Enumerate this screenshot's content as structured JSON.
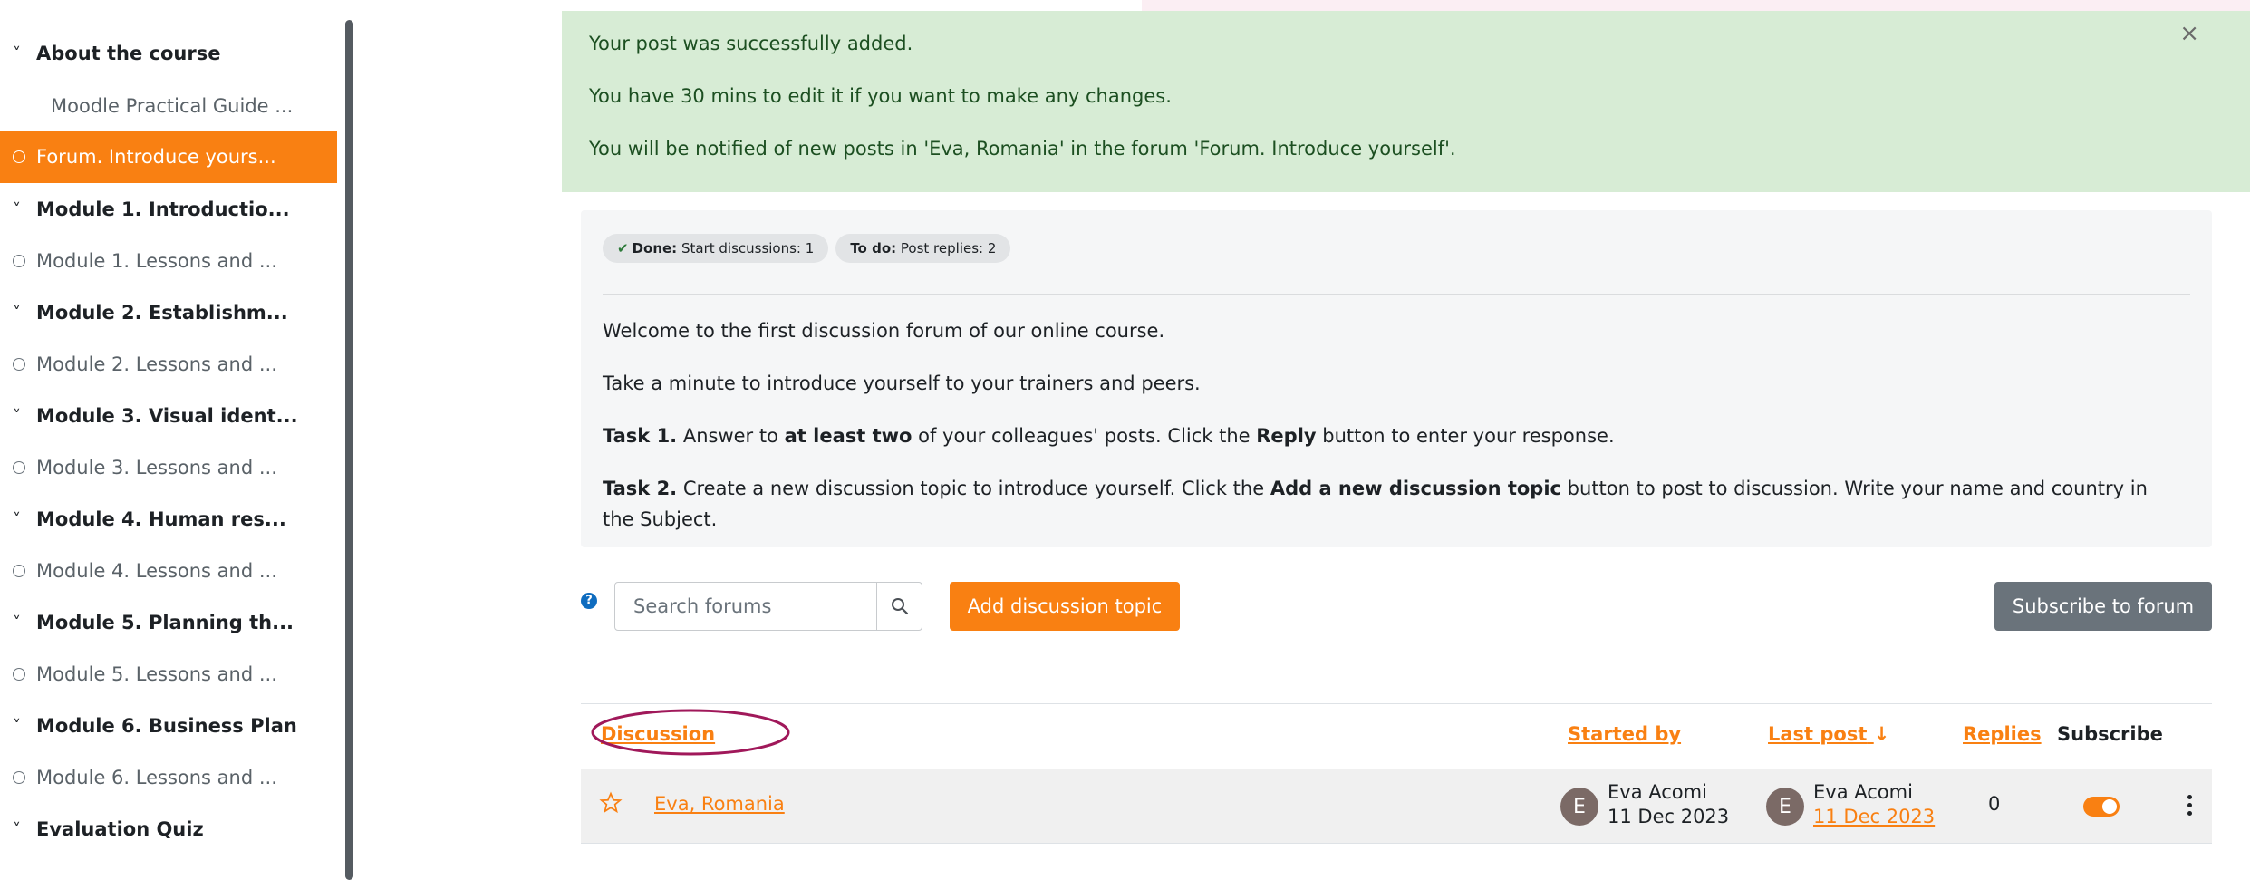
{
  "sidebar": {
    "items": [
      {
        "label": "About the course",
        "kind": "section"
      },
      {
        "label": "Moodle Practical Guide ...",
        "kind": "indent"
      },
      {
        "label": "Forum. Introduce yours...",
        "kind": "activity",
        "active": true
      },
      {
        "label": "Module 1. Introductio...",
        "kind": "section"
      },
      {
        "label": "Module 1. Lessons and ...",
        "kind": "activity"
      },
      {
        "label": "Module 2. Establishm...",
        "kind": "section"
      },
      {
        "label": "Module 2. Lessons and ...",
        "kind": "activity"
      },
      {
        "label": "Module 3. Visual ident...",
        "kind": "section"
      },
      {
        "label": "Module 3. Lessons and ...",
        "kind": "activity"
      },
      {
        "label": "Module 4. Human res...",
        "kind": "section"
      },
      {
        "label": "Module 4. Lessons and ...",
        "kind": "activity"
      },
      {
        "label": "Module 5. Planning th...",
        "kind": "section"
      },
      {
        "label": "Module 5. Lessons and ...",
        "kind": "activity"
      },
      {
        "label": "Module 6. Business Plan",
        "kind": "section"
      },
      {
        "label": "Module 6. Lessons and ...",
        "kind": "activity"
      },
      {
        "label": "Evaluation Quiz",
        "kind": "section"
      }
    ]
  },
  "alert": {
    "line1": "Your post was successfully added.",
    "line2": "You have 30 mins to edit it if you want to make any changes.",
    "line3": "You will be notified of new posts in 'Eva, Romania' in the forum 'Forum. Introduce yourself'.",
    "close": "×"
  },
  "intro": {
    "done_label": "Done:",
    "done_text": "Start discussions: 1",
    "todo_label": "To do:",
    "todo_text": "Post replies: 2",
    "p1": "Welcome to the first discussion forum of our online course.",
    "p2": "Take a minute to introduce yourself to your trainers and peers.",
    "task1_label": "Task 1.",
    "task1_a": " Answer to ",
    "task1_b": "at least two",
    "task1_c": " of your colleagues' posts. Click the ",
    "task1_d": "Reply",
    "task1_e": " button to enter your response.",
    "task2_label": "Task 2.",
    "task2_a": " Create a new discussion topic to introduce yourself. Click the ",
    "task2_b": "Add a new discussion topic",
    "task2_c": " button to post to discussion. Write your name and country in the Subject."
  },
  "actions": {
    "search_placeholder": "Search forums",
    "add_topic": "Add discussion topic",
    "subscribe_forum": "Subscribe to forum"
  },
  "table": {
    "headers": {
      "discussion": "Discussion",
      "started_by": "Started by",
      "last_post": "Last post",
      "sort_arrow": "↓",
      "replies": "Replies",
      "subscribe": "Subscribe"
    },
    "rows": [
      {
        "title": "Eva, Romania",
        "started_initial": "E",
        "started_name": "Eva Acomi",
        "started_date": "11 Dec 2023",
        "last_initial": "E",
        "last_name": "Eva Acomi",
        "last_date": "11 Dec 2023",
        "replies": "0",
        "subscribed": true
      }
    ]
  },
  "colors": {
    "accent": "#f98012",
    "alert_bg": "#d7ecd5",
    "annotation": "#a0185a"
  }
}
